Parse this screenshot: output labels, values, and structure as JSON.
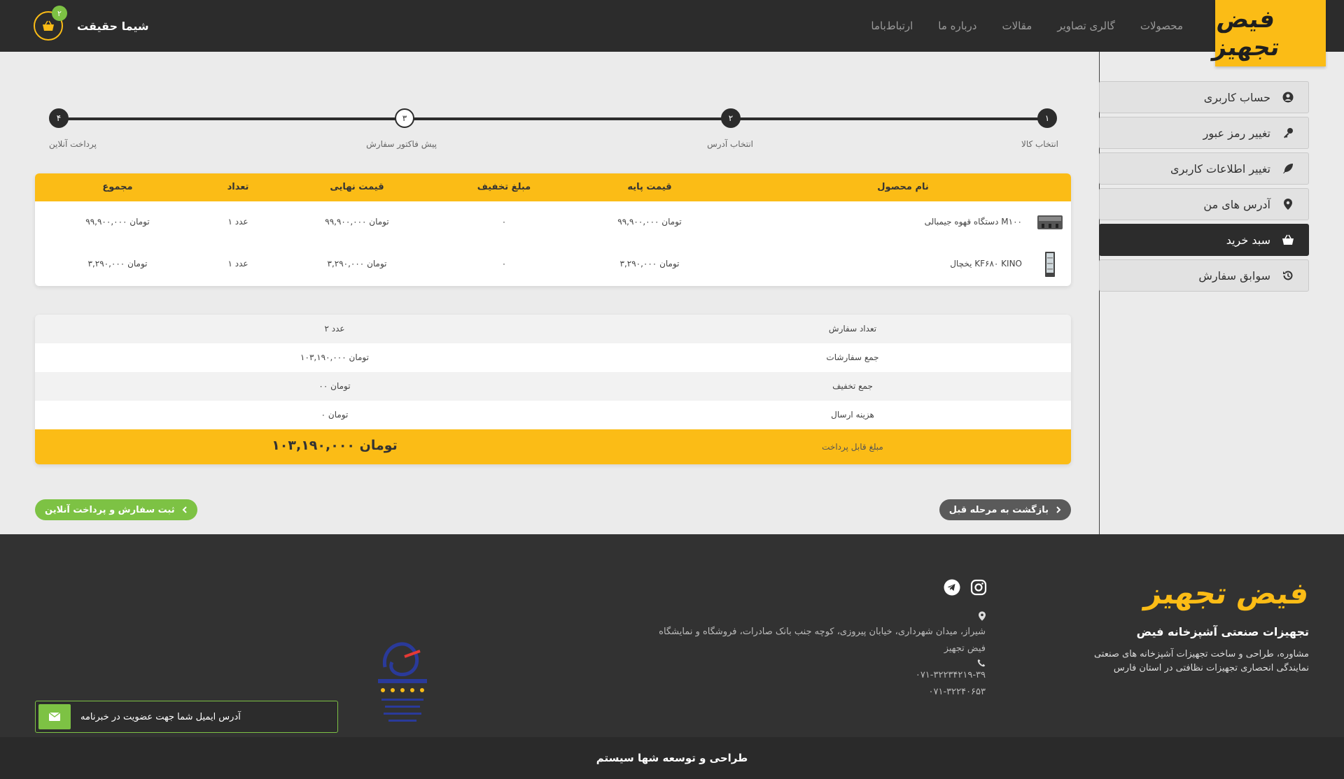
{
  "header": {
    "logo": "فیض تجهیز",
    "nav": [
      "محصولات",
      "گالری تصاویر",
      "مقالات",
      "درباره ما",
      "ارتباط‌باما"
    ],
    "user_name": "شیما حقیقت",
    "cart_count": "۲"
  },
  "sidebar": {
    "items": [
      {
        "label": "حساب کاربری",
        "icon": "user-circle-icon"
      },
      {
        "label": "تغییر رمز عبور",
        "icon": "key-icon"
      },
      {
        "label": "تغییر اطلاعات کاربری",
        "icon": "feather-icon"
      },
      {
        "label": "آدرس های من",
        "icon": "map-marker-icon"
      },
      {
        "label": "سبد خرید",
        "icon": "basket-icon"
      },
      {
        "label": "سوابق سفارش",
        "icon": "history-icon"
      }
    ]
  },
  "stepper": {
    "steps": [
      {
        "num": "۱",
        "label": "انتخاب کالا"
      },
      {
        "num": "۲",
        "label": "انتخاب آدرس"
      },
      {
        "num": "۳",
        "label": "پیش فاکتور سفارش"
      },
      {
        "num": "۴",
        "label": "پرداخت آنلاین"
      }
    ]
  },
  "products": {
    "headers": {
      "name": "نام محصول",
      "base_price": "قیمت پایه",
      "discount": "مبلغ تخفیف",
      "final_price": "قیمت نهایی",
      "qty": "تعداد",
      "total": "مجموع"
    },
    "rows": [
      {
        "name": "دستگاه قهوه جیمبالی M۱۰۰",
        "base_price": "۹۹,۹۰۰,۰۰۰ تومان",
        "discount": "۰",
        "final_price": "۹۹,۹۰۰,۰۰۰ تومان",
        "qty": "۱ عدد",
        "total": "۹۹,۹۰۰,۰۰۰ تومان"
      },
      {
        "name": "یخچال KF۶۸۰ KINO",
        "base_price": "۳,۲۹۰,۰۰۰ تومان",
        "discount": "۰",
        "final_price": "۳,۲۹۰,۰۰۰ تومان",
        "qty": "۱ عدد",
        "total": "۳,۲۹۰,۰۰۰ تومان"
      }
    ]
  },
  "summary": {
    "rows": [
      {
        "label": "تعداد سفارش",
        "value": "۲ عدد"
      },
      {
        "label": "جمع سفارشات",
        "value": "۱۰۳,۱۹۰,۰۰۰ تومان"
      },
      {
        "label": "جمع تخفیف",
        "value": "۰۰ تومان"
      },
      {
        "label": "هزینه ارسال",
        "value": "۰ تومان"
      }
    ],
    "total_label": "مبلغ قابل پرداخت",
    "total_value": "۱۰۳,۱۹۰,۰۰۰ تومان"
  },
  "buttons": {
    "back": "بازگشت به مرحله قبل",
    "pay": "ثبت سفارش و پرداخت آنلاین"
  },
  "footer": {
    "logo": "فیض تجهیز",
    "title": "تجهیزات صنعتی آشپزخانه فیض",
    "desc_line1": "مشاوره، طراحی و ساخت تجهیزات آشپزخانه های صنعتی",
    "desc_line2": "نمایندگی انحصاری تجهیزات نظافتی در استان فارس",
    "address_line1": "شیراز، میدان شهرداری، خیابان پیروزی، کوچه جنب بانک صادرات، فروشگاه و نمایشگاه",
    "address_line2": "فیض تجهیز",
    "phone1": "۰۷۱-۳۲۲۳۴۲۱۹-۳۹",
    "phone2": "۰۷۱-۳۲۲۴۰۶۵۳",
    "newsletter_placeholder": "آدرس ایمیل شما جهت عضویت در خبرنامه",
    "copyright": "طراحی و توسعه شها سیستم"
  }
}
